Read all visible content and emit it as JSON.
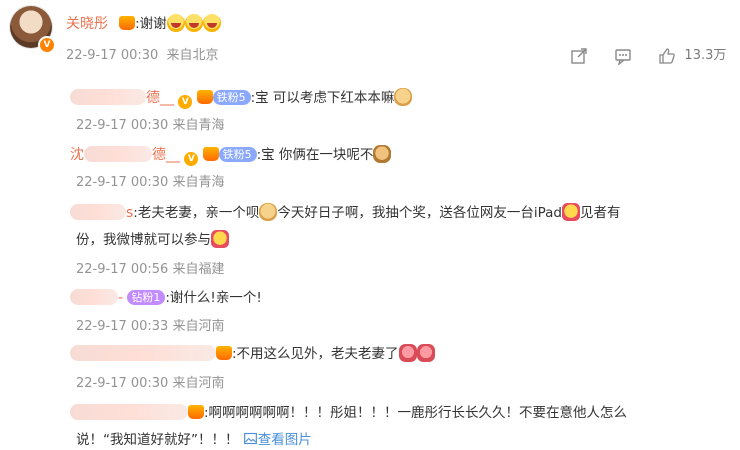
{
  "post": {
    "author": "关晓彤",
    "text": ":谢谢",
    "time": "22-9-17 00:30",
    "source": "来自北京",
    "likes": "13.3万"
  },
  "comments": [
    {
      "author_visible": "德__",
      "fan_badge": "铁粉5",
      "text": ":宝 可以考虑下红本本嘛",
      "time": "22-9-17 00:30",
      "location": "来自青海"
    },
    {
      "author_visible_prefix": "沈",
      "author_visible": "德__",
      "fan_badge": "铁粉5",
      "text": ":宝 你俩在一块呢不",
      "time": "22-9-17 00:30",
      "location": "来自青海"
    },
    {
      "author_visible": "s",
      "text_line1": ":老夫老妻，亲一个呗",
      "text_line1b": "今天好日子啊，我抽个奖，送各位网友一台iPad",
      "text_line1c": "见者有",
      "text_line2": "份，我微博就可以参与",
      "time": "22-9-17 00:56",
      "location": "来自福建"
    },
    {
      "author_visible": "-",
      "fan_badge": "钻粉1",
      "text": ":谢什么!亲一个!",
      "time": "22-9-17 00:33",
      "location": "来自河南"
    },
    {
      "text": ":不用这么见外，老夫老妻了",
      "time": "22-9-17 00:30",
      "location": "来自河南"
    },
    {
      "text_line1": ":啊啊啊啊啊啊！！！彤姐！！！一鹿彤行长长久久！不要在意他人怎么",
      "text_line2": "说！“我知道好就好”！！！",
      "view_image": "查看图片"
    }
  ]
}
